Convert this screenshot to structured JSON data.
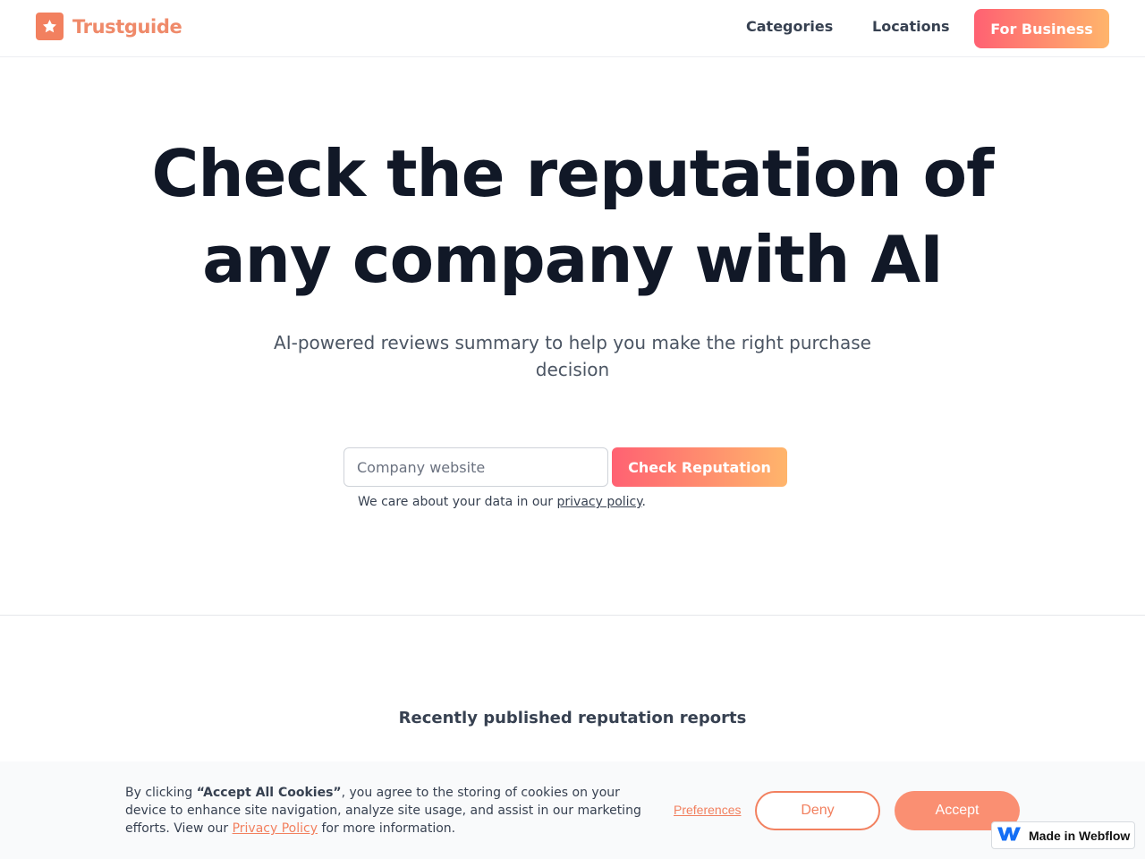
{
  "header": {
    "logo_text": "Trustguide",
    "logo_icon": "star-icon",
    "nav": {
      "categories": "Categories",
      "locations": "Locations"
    },
    "cta": "For Business"
  },
  "hero": {
    "title_line1": "Check the reputation of",
    "title_line2": "any company with AI",
    "subtitle": "AI-powered reviews summary to help you make the right purchase decision",
    "search": {
      "placeholder": "Company website",
      "value": "",
      "button": "Check Reputation"
    },
    "privacy": {
      "prefix": "We care about your data in our ",
      "link": "privacy policy",
      "suffix": "."
    }
  },
  "recent": {
    "heading": "Recently published reputation reports"
  },
  "cookie": {
    "text_prefix": "By clicking ",
    "text_bold": "“Accept All Cookies”",
    "text_middle": ", you agree to the storing of cookies on your device to enhance site navigation, analyze site usage, and assist in our marketing efforts. View our ",
    "link": "Privacy Policy",
    "text_suffix": " for more information.",
    "preferences": "Preferences",
    "deny": "Deny",
    "accept": "Accept"
  },
  "badge": {
    "text": "Made in Webflow",
    "icon": "webflow-icon"
  },
  "colors": {
    "brand": "#f2805f",
    "gradient_start": "#ff6172",
    "gradient_end": "#ffb56b",
    "text_dark": "#111827",
    "text_muted": "#4b5563"
  }
}
